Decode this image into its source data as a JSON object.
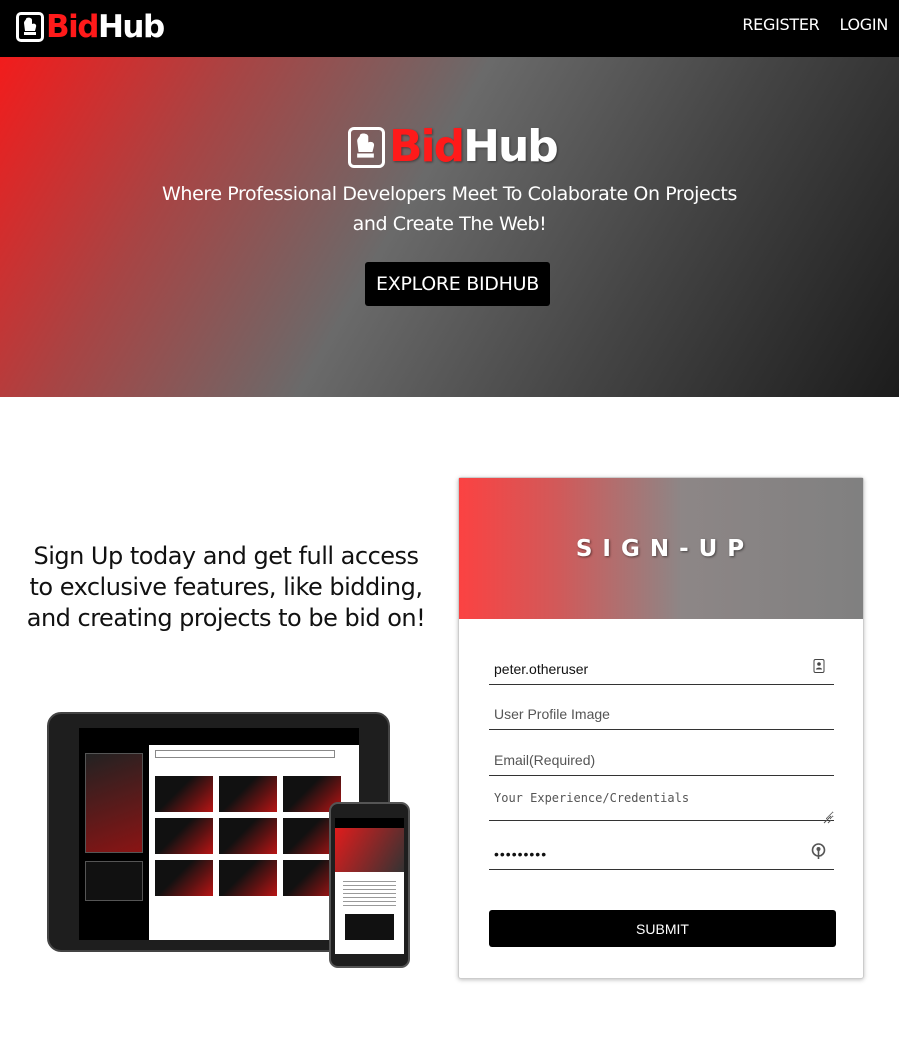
{
  "nav": {
    "logo_bid": "Bid",
    "logo_hub": "Hub",
    "register_label": "REGISTER",
    "login_label": "LOGIN"
  },
  "hero": {
    "logo_bid": "Bid",
    "logo_hub": "Hub",
    "tagline": "Where Professional Developers Meet To Colaborate On Projects and Create The Web!",
    "explore_label": "EXPLORE BIDHUB"
  },
  "promo": {
    "text": "Sign Up today and get full access to exclusive features, like bidding, and creating projects to be bid on!"
  },
  "signup": {
    "title": "SIGN-UP",
    "username_value": "peter.otheruser",
    "profile_image_placeholder": "User Profile Image",
    "email_placeholder": "Email(Required)",
    "experience_placeholder": "Your Experience/Credentials",
    "password_value": "•••••••••",
    "submit_label": "SUBMIT"
  },
  "colors": {
    "brand_red": "#ff1a1a",
    "nav_bg": "#000000",
    "button_bg": "#000000"
  },
  "icons": {
    "logo": "oven-mitt-icon",
    "username": "contact-card-icon",
    "password": "key-icon"
  }
}
